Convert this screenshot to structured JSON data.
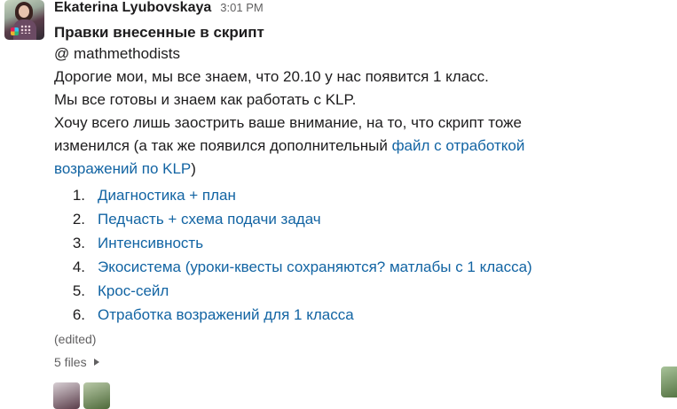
{
  "message": {
    "author": "Ekaterina Lyubovskaya",
    "time": "3:01 PM",
    "title": "Правки внесенные в скрипт",
    "mention": "@ mathmethodists",
    "lines": [
      "Дорогие мои, мы все знаем, что 20.10 у нас появится 1 класс.",
      "Мы все готовы и знаем как работать с KLP."
    ],
    "para_line1": "Хочу всего лишь заострить ваше внимание, на то, что скрипт тоже",
    "para_line2_start": "изменился (а так же появился дополнительный ",
    "para_link_a": "файл с отработкой",
    "para_link_b": "возражений по KLP",
    "para_end": ")",
    "list": [
      {
        "num": "1.",
        "text": "Диагностика + план"
      },
      {
        "num": "2.",
        "text": "Педчасть + схема подачи задач"
      },
      {
        "num": "3.",
        "text": "Интенсивность"
      },
      {
        "num": "4.",
        "text": "Экосистема (уроки-квесты сохраняются? матлабы с 1 класса)"
      },
      {
        "num": "5.",
        "text": "Крос-сейл"
      },
      {
        "num": "6.",
        "text": "Отработка возражений для 1 класса"
      }
    ],
    "edited": "(edited)",
    "files": "5 files"
  },
  "colors": {
    "link": "#1264a3",
    "text": "#1d1c1d",
    "muted": "#616061"
  },
  "icons": {
    "files_toggle": "caret-right-icon"
  }
}
